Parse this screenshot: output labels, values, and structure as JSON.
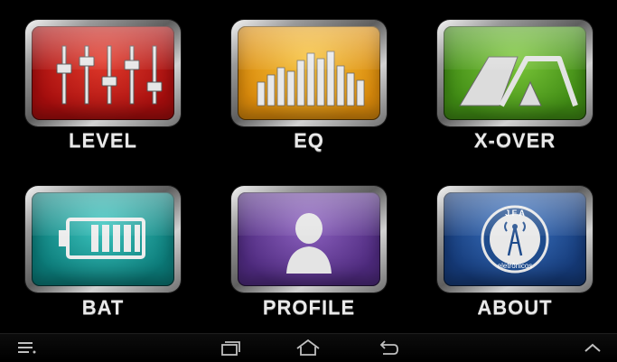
{
  "tiles": [
    {
      "id": "level",
      "label": "LEVEL",
      "color": "#c21212",
      "icon": "sliders-icon"
    },
    {
      "id": "eq",
      "label": "EQ",
      "color": "#e8a20c",
      "icon": "equalizer-bars-icon"
    },
    {
      "id": "xover",
      "label": "X-OVER",
      "color": "#4ea11b",
      "icon": "crossover-filter-icon"
    },
    {
      "id": "bat",
      "label": "BAT",
      "color": "#12928f",
      "icon": "battery-icon"
    },
    {
      "id": "profile",
      "label": "PROFILE",
      "color": "#6a3e9b",
      "icon": "user-profile-icon"
    },
    {
      "id": "about",
      "label": "ABOUT",
      "color": "#1f4f97",
      "icon": "jfa-logo-icon"
    }
  ],
  "about_logo": {
    "top_text": "J F A",
    "bottom_text": "eletrônicos"
  },
  "navbar": {
    "icons": [
      "menu-icon",
      "recent-apps-icon",
      "home-icon",
      "back-icon",
      "expand-up-icon"
    ]
  }
}
